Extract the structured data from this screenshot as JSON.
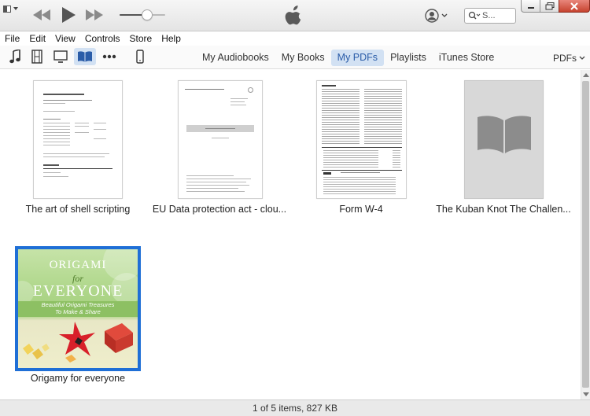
{
  "window": {
    "system_menu_icon": "window-menu-icon",
    "buttons": [
      "minimize-icon",
      "maximize-icon",
      "close-icon"
    ]
  },
  "player": {
    "controls": [
      "rewind-icon",
      "play-icon",
      "fast-forward-icon"
    ],
    "volume_level": 0.6,
    "logo": "apple-logo-icon"
  },
  "account_icon": "account-icon",
  "search": {
    "placeholder": "S..."
  },
  "menu": [
    "File",
    "Edit",
    "View",
    "Controls",
    "Store",
    "Help"
  ],
  "media_types": [
    "music-icon",
    "movies-icon",
    "tv-icon",
    "books-icon",
    "more-icon",
    "device-icon"
  ],
  "tabs": [
    {
      "label": "My Audiobooks",
      "selected": false
    },
    {
      "label": "My Books",
      "selected": false
    },
    {
      "label": "My PDFs",
      "selected": true
    },
    {
      "label": "Playlists",
      "selected": false
    },
    {
      "label": "iTunes Store",
      "selected": false
    }
  ],
  "view_selector": "PDFs",
  "items": [
    {
      "title": "The art of shell scripting",
      "thumbnail": "document-preview"
    },
    {
      "title": "EU Data protection act - clou...",
      "thumbnail": "document-preview"
    },
    {
      "title": "Form W-4",
      "thumbnail": "form-preview"
    },
    {
      "title": "The Kuban Knot The Challen...",
      "thumbnail": "book-placeholder-icon"
    },
    {
      "title": "Origamy for everyone",
      "thumbnail": "origami-cover",
      "selected": true
    }
  ],
  "origami_cover": {
    "line1": "ORIGAMI",
    "line2": "for",
    "line3": "EVERYONE",
    "subtitle1": "Beautiful Origami Treasures",
    "subtitle2": "To Make & Share"
  },
  "status": "1 of 5 items, 827 KB",
  "colors": {
    "accent": "#1f6fd6",
    "tab_selected_bg": "#d2e1f3",
    "tab_selected_text": "#2a5ca8"
  }
}
